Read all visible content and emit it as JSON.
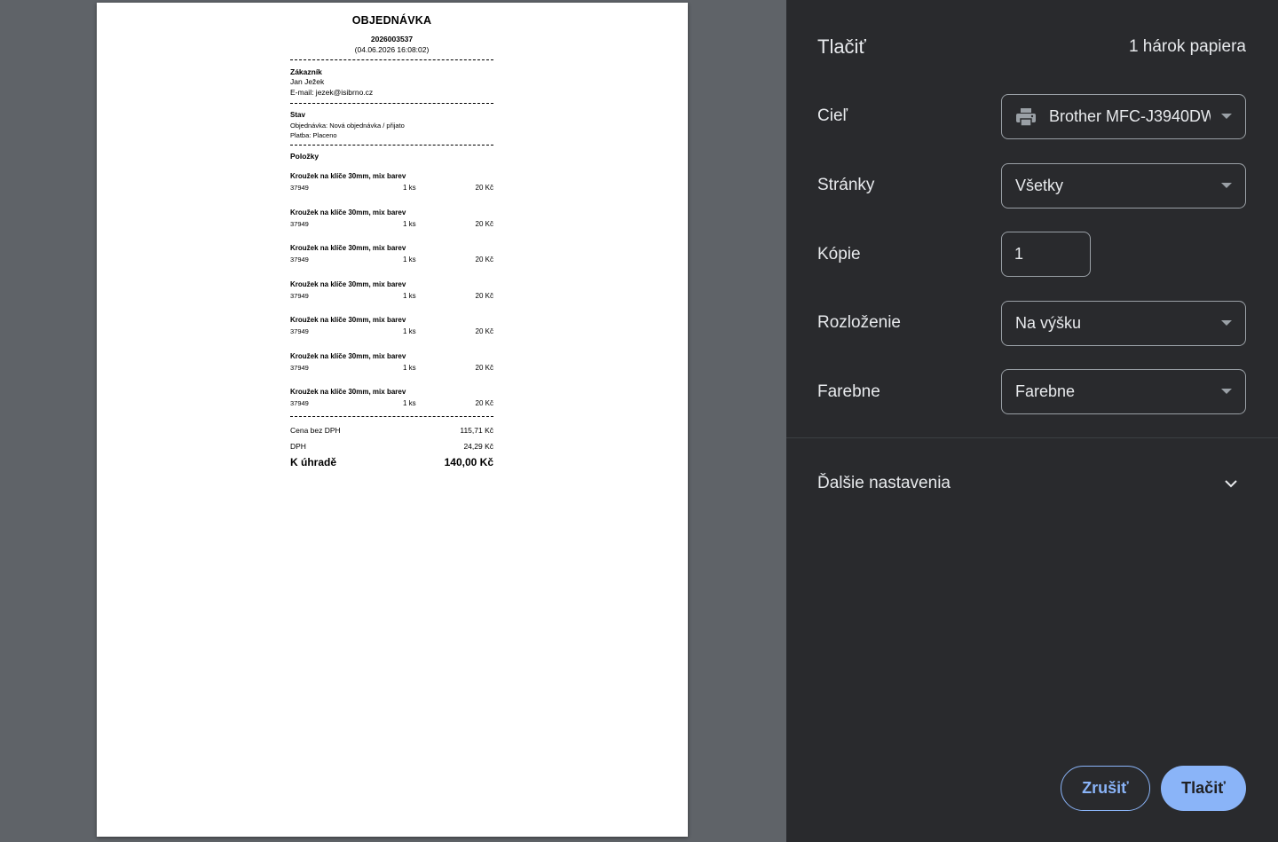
{
  "receipt": {
    "title": "OBJEDNÁVKA",
    "order_number": "2026003537",
    "datetime": "(04.06.2026 16:08:02)",
    "customer_heading": "Zákazník",
    "customer_name": "Jan Ježek",
    "customer_email": "E-mail: jezek@isibrno.cz",
    "status_heading": "Stav",
    "status_order": "Objednávka: Nová objednávka / přijato",
    "status_payment": "Platba: Placeno",
    "items_heading": "Položky",
    "items": [
      {
        "name": "Kroužek na klíče 30mm, mix barev",
        "code": "37949",
        "qty": "1 ks",
        "price": "20 Kč"
      },
      {
        "name": "Kroužek na klíče 30mm, mix barev",
        "code": "37949",
        "qty": "1 ks",
        "price": "20 Kč"
      },
      {
        "name": "Kroužek na klíče 30mm, mix barev",
        "code": "37949",
        "qty": "1 ks",
        "price": "20 Kč"
      },
      {
        "name": "Kroužek na klíče 30mm, mix barev",
        "code": "37949",
        "qty": "1 ks",
        "price": "20 Kč"
      },
      {
        "name": "Kroužek na klíče 30mm, mix barev",
        "code": "37949",
        "qty": "1 ks",
        "price": "20 Kč"
      },
      {
        "name": "Kroužek na klíče 30mm, mix barev",
        "code": "37949",
        "qty": "1 ks",
        "price": "20 Kč"
      },
      {
        "name": "Kroužek na klíče 30mm, mix barev",
        "code": "37949",
        "qty": "1 ks",
        "price": "20 Kč"
      }
    ],
    "totals": {
      "net_label": "Cena bez DPH",
      "net_value": "115,71 Kč",
      "vat_label": "DPH",
      "vat_value": "24,29 Kč",
      "due_label": "K úhradě",
      "due_value": "140,00 Kč"
    }
  },
  "panel": {
    "title": "Tlačiť",
    "sheet_count": "1 hárok papiera",
    "destination_label": "Cieľ",
    "destination_value": "Brother MFC-J3940DW",
    "destination_icon": "printer-icon",
    "pages_label": "Stránky",
    "pages_value": "Všetky",
    "copies_label": "Kópie",
    "copies_value": "1",
    "layout_label": "Rozloženie",
    "layout_value": "Na výšku",
    "color_label": "Farebne",
    "color_value": "Farebne",
    "more_settings": "Ďalšie nastavenia",
    "cancel_button": "Zrušiť",
    "print_button": "Tlačiť"
  },
  "colors": {
    "panel_bg": "#292a2d",
    "preview_bg": "#5f6368",
    "accent": "#8ab4f8"
  }
}
